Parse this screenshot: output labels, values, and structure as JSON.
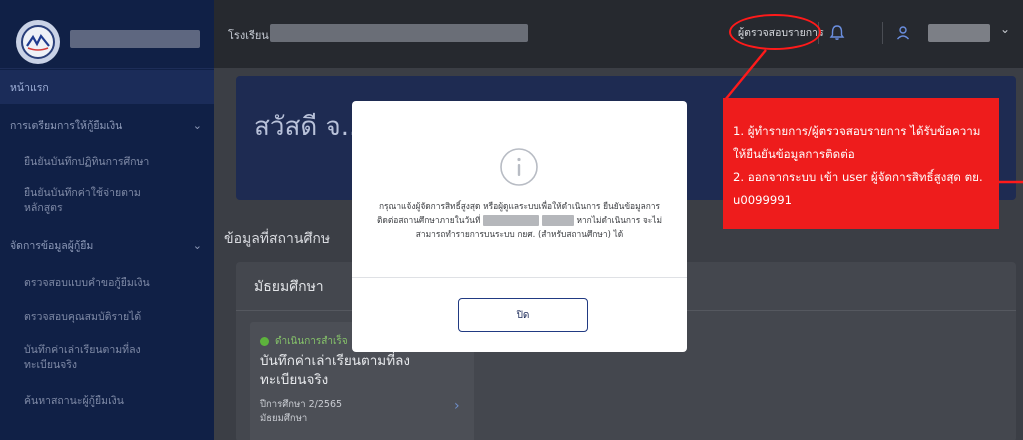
{
  "sidebar": {
    "items": [
      {
        "label": "หน้าแรก",
        "kind": "home"
      },
      {
        "label": "การเตรียมการให้กู้ยืมเงิน",
        "kind": "section",
        "chevron": "chevron-down-icon"
      },
      {
        "label": "ยืนยันบันทึกปฏิทินการศึกษา",
        "kind": "sub"
      },
      {
        "label": "ยืนยันบันทึกค่าใช้จ่ายตามหลักสูตร",
        "kind": "sub"
      },
      {
        "label": "จัดการข้อมูลผู้กู้ยืม",
        "kind": "section",
        "chevron": "chevron-down-icon"
      },
      {
        "label": "ตรวจสอบแบบคำขอกู้ยืมเงิน",
        "kind": "sub"
      },
      {
        "label": "ตรวจสอบคุณสมบัติรายได้",
        "kind": "sub"
      },
      {
        "label": "บันทึกค่าเล่าเรียนตามที่ลงทะเบียนจริง",
        "kind": "sub"
      },
      {
        "label": "ค้นหาสถานะผู้กู้ยืมเงิน",
        "kind": "sub"
      }
    ]
  },
  "header": {
    "school_label": "โรงเรียน",
    "inspector_label": "ผู้ตรวจสอบรายการ"
  },
  "main": {
    "banner_title": "สวัสดี จ...",
    "section_title": "ข้อมูลที่สถานศึกษ",
    "level_title": "มัธยมศึกษา",
    "card": {
      "status": "ดำเนินการสำเร็จ",
      "title": "บันทึกค่าเล่าเรียนตามที่ลงทะเบียนจริง",
      "term": "ปีการศึกษา 2/2565",
      "level": "มัธยมศึกษา"
    }
  },
  "modal": {
    "message_1": "กรุณาแจ้งผู้จัดการสิทธิ์สูงสุด หรือผู้ดูแลระบบเพื่อให้ดำเนินการ ยืนยันข้อมูลการติดต่อสถานศึกษาภายในวันที่",
    "message_2": "หากไม่ดำเนินการ จะไม่สามารถทำรายการบนระบบ กยศ. (สำหรับสถานศึกษา) ได้",
    "close_label": "ปิด"
  },
  "annotation": {
    "line_1": "1. ผู้ทำรายการ/ผู้ตรวจสอบรายการ ได้รับข้อความ ให้ยืนยันข้อมูลการติดต่อ",
    "line_2": "2. ออกจากระบบ เข้า user ผู้จัดการสิทธิ์สูงสุด ตย. u0099991",
    "color": "#ee1c1c"
  }
}
